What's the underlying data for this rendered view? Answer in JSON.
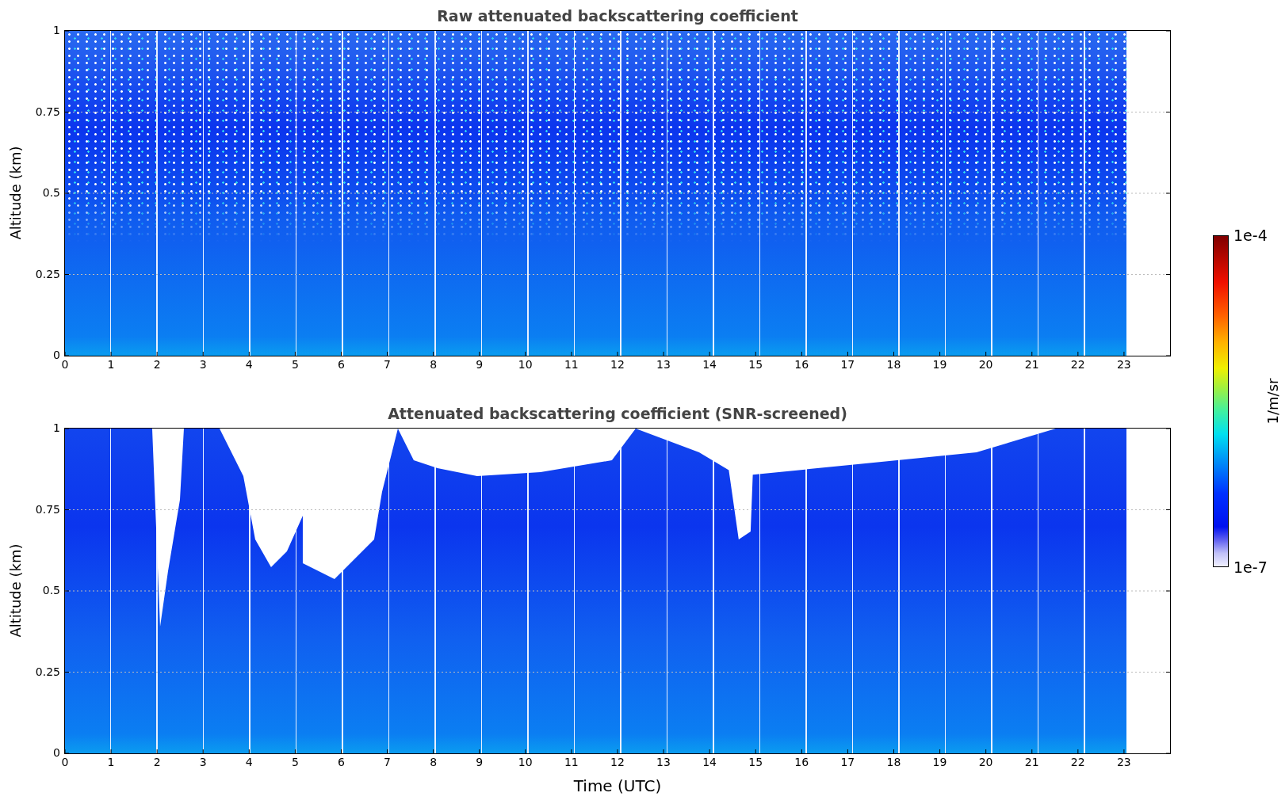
{
  "panels": [
    {
      "kind": "raw",
      "title": "Raw attenuated backscattering coefficient",
      "ylabel": "Altitude (km)",
      "yticks": [
        "1",
        "0.75",
        "0.5",
        "0.25",
        "0"
      ],
      "xticks": [
        "0",
        "1",
        "2",
        "3",
        "4",
        "5",
        "6",
        "7",
        "8",
        "9",
        "10",
        "11",
        "12",
        "13",
        "14",
        "15",
        "16",
        "17",
        "18",
        "19",
        "20",
        "21",
        "22",
        "23"
      ]
    },
    {
      "kind": "screened",
      "title": "Attenuated backscattering coefficient (SNR-screened)",
      "ylabel": "Altitude (km)",
      "yticks": [
        "1",
        "0.75",
        "0.5",
        "0.25",
        "0"
      ],
      "xticks": [
        "0",
        "1",
        "2",
        "3",
        "4",
        "5",
        "6",
        "7",
        "8",
        "9",
        "10",
        "11",
        "12",
        "13",
        "14",
        "15",
        "16",
        "17",
        "18",
        "19",
        "20",
        "21",
        "22",
        "23"
      ]
    }
  ],
  "xlabel": "Time (UTC)",
  "colorbar": {
    "max_label": "1e-4",
    "min_label": "1e-7",
    "unit": "1/m/sr"
  }
}
